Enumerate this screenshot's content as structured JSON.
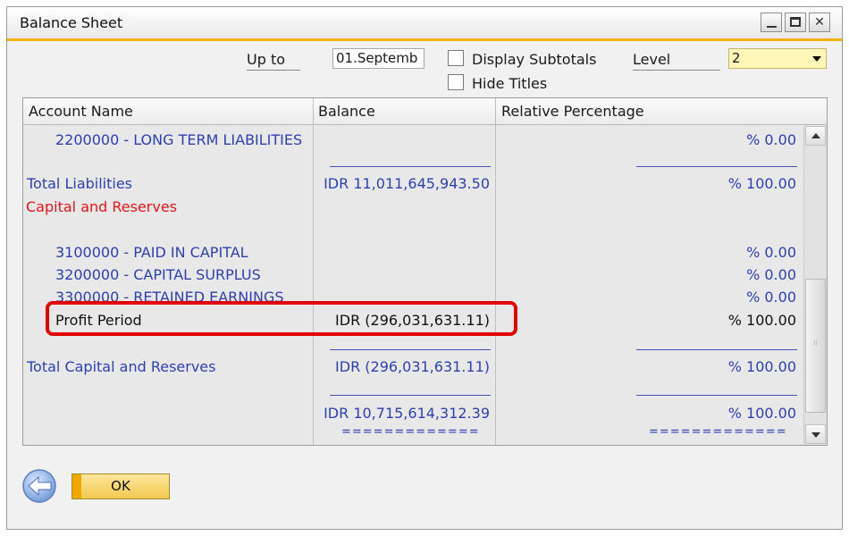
{
  "window": {
    "title": "Balance Sheet"
  },
  "header": {
    "upto_label": "Up to",
    "upto_value": "01.Septemb",
    "display_subtotals_label": "Display Subtotals",
    "display_subtotals_checked": false,
    "hide_titles_label": "Hide Titles",
    "hide_titles_checked": false,
    "level_label": "Level",
    "level_value": "2"
  },
  "grid": {
    "columns": [
      "Account Name",
      "Balance",
      "Relative Percentage"
    ],
    "rows": [
      {
        "name": "2200000 - LONG TERM LIABILITIES",
        "balance": "",
        "percent": "% 0.00"
      },
      {
        "name": "Total Liabilities",
        "balance": "IDR  11,011,645,943.50",
        "percent": "% 100.00"
      },
      {
        "name": "Capital and Reserves",
        "balance": "",
        "percent": ""
      },
      {
        "name": "3100000 - PAID IN CAPITAL",
        "balance": "",
        "percent": "% 0.00"
      },
      {
        "name": "3200000 - CAPITAL SURPLUS",
        "balance": "",
        "percent": "% 0.00"
      },
      {
        "name": "3300000 - RETAINED EARNINGS",
        "balance": "",
        "percent": "% 0.00"
      },
      {
        "name": "Profit Period",
        "balance": "IDR (296,031,631.11)",
        "percent": "% 100.00"
      },
      {
        "name": "Total Capital and Reserves",
        "balance": "IDR (296,031,631.11)",
        "percent": "% 100.00"
      },
      {
        "name": "",
        "balance": "IDR  10,715,614,312.39",
        "percent": "% 100.00"
      }
    ],
    "double_rule": "============="
  },
  "footer": {
    "ok_label": "OK"
  },
  "colors": {
    "accent": "#f2b200",
    "link_blue": "#2d3fb0",
    "title_red": "#e6141c",
    "highlight": "#e00000"
  }
}
